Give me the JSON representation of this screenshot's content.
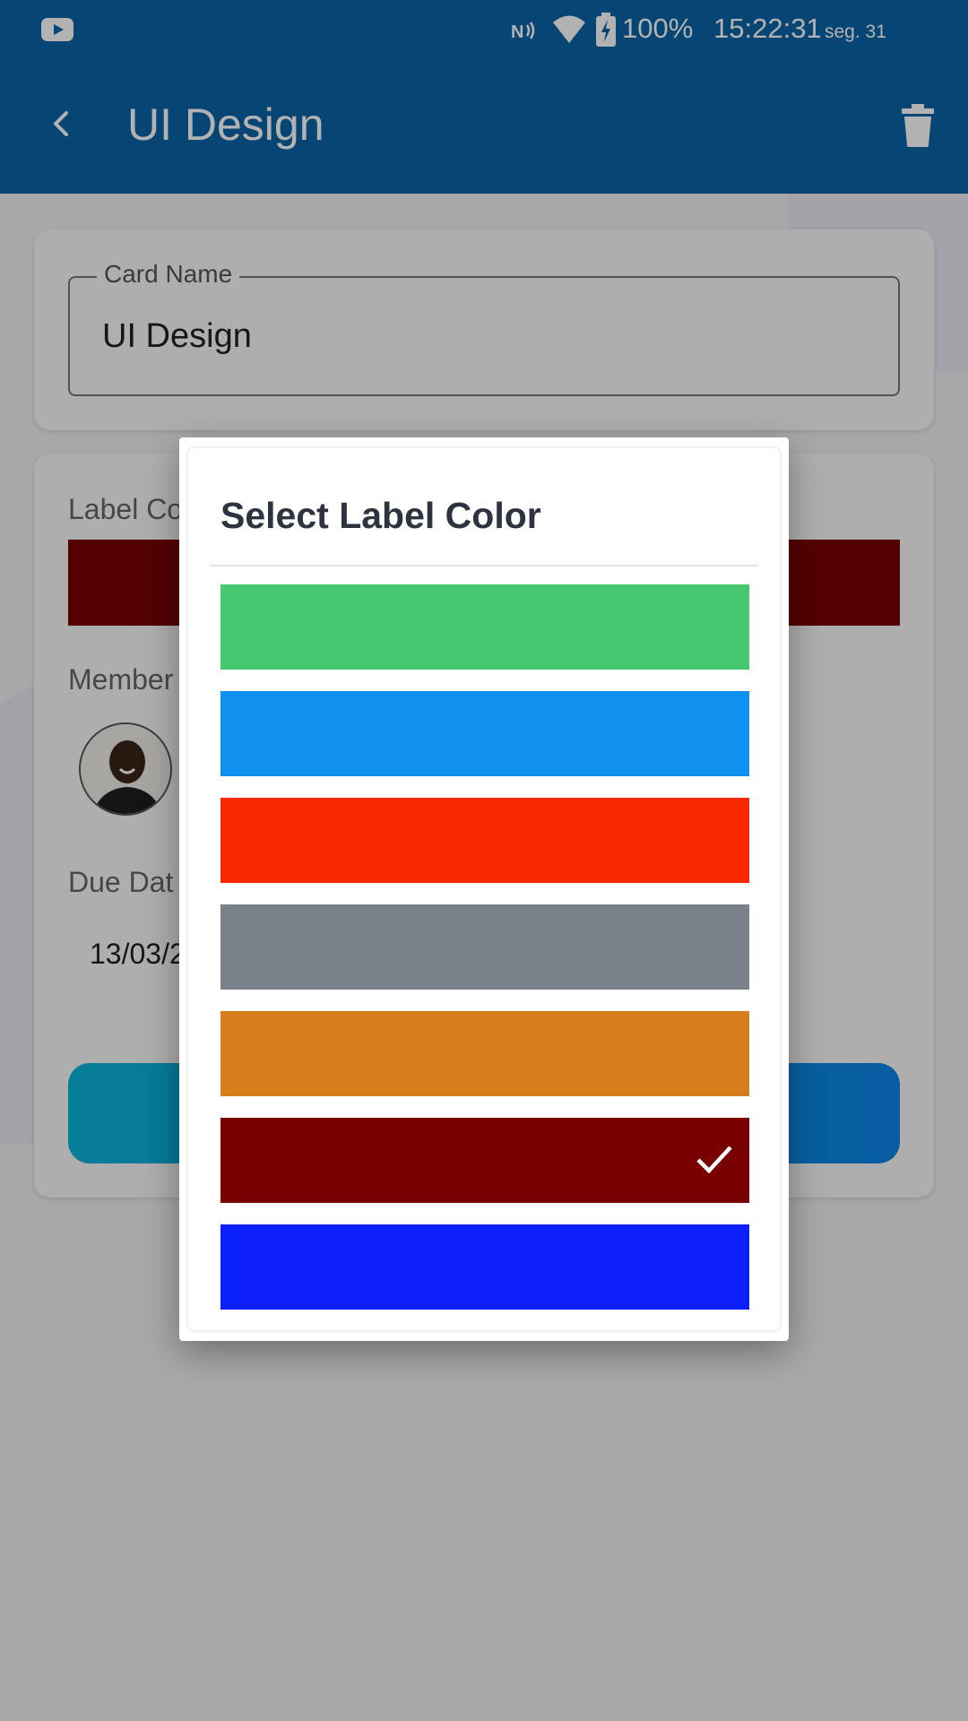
{
  "status_bar": {
    "battery": "100%",
    "time": "15:22:31",
    "date": "seg. 31"
  },
  "app_bar": {
    "title": "UI Design",
    "back_icon": "chevron-left-icon",
    "delete_icon": "trash-icon"
  },
  "card_name": {
    "label": "Card Name",
    "value": "UI Design"
  },
  "card_details": {
    "label_color_title": "Label Co",
    "label_color": "#790000",
    "members_title": "Member",
    "due_date_title": "Due Dat",
    "due_date_value": "13/03/2"
  },
  "dialog": {
    "title": "Select Label Color",
    "colors": [
      {
        "hex": "#46c86e",
        "selected": false
      },
      {
        "hex": "#0f91f0",
        "selected": false
      },
      {
        "hex": "#f82800",
        "selected": false
      },
      {
        "hex": "#7b818b",
        "selected": false
      },
      {
        "hex": "#d67d1c",
        "selected": false
      },
      {
        "hex": "#790000",
        "selected": true
      },
      {
        "hex": "#0a1ffc",
        "selected": false
      }
    ]
  }
}
